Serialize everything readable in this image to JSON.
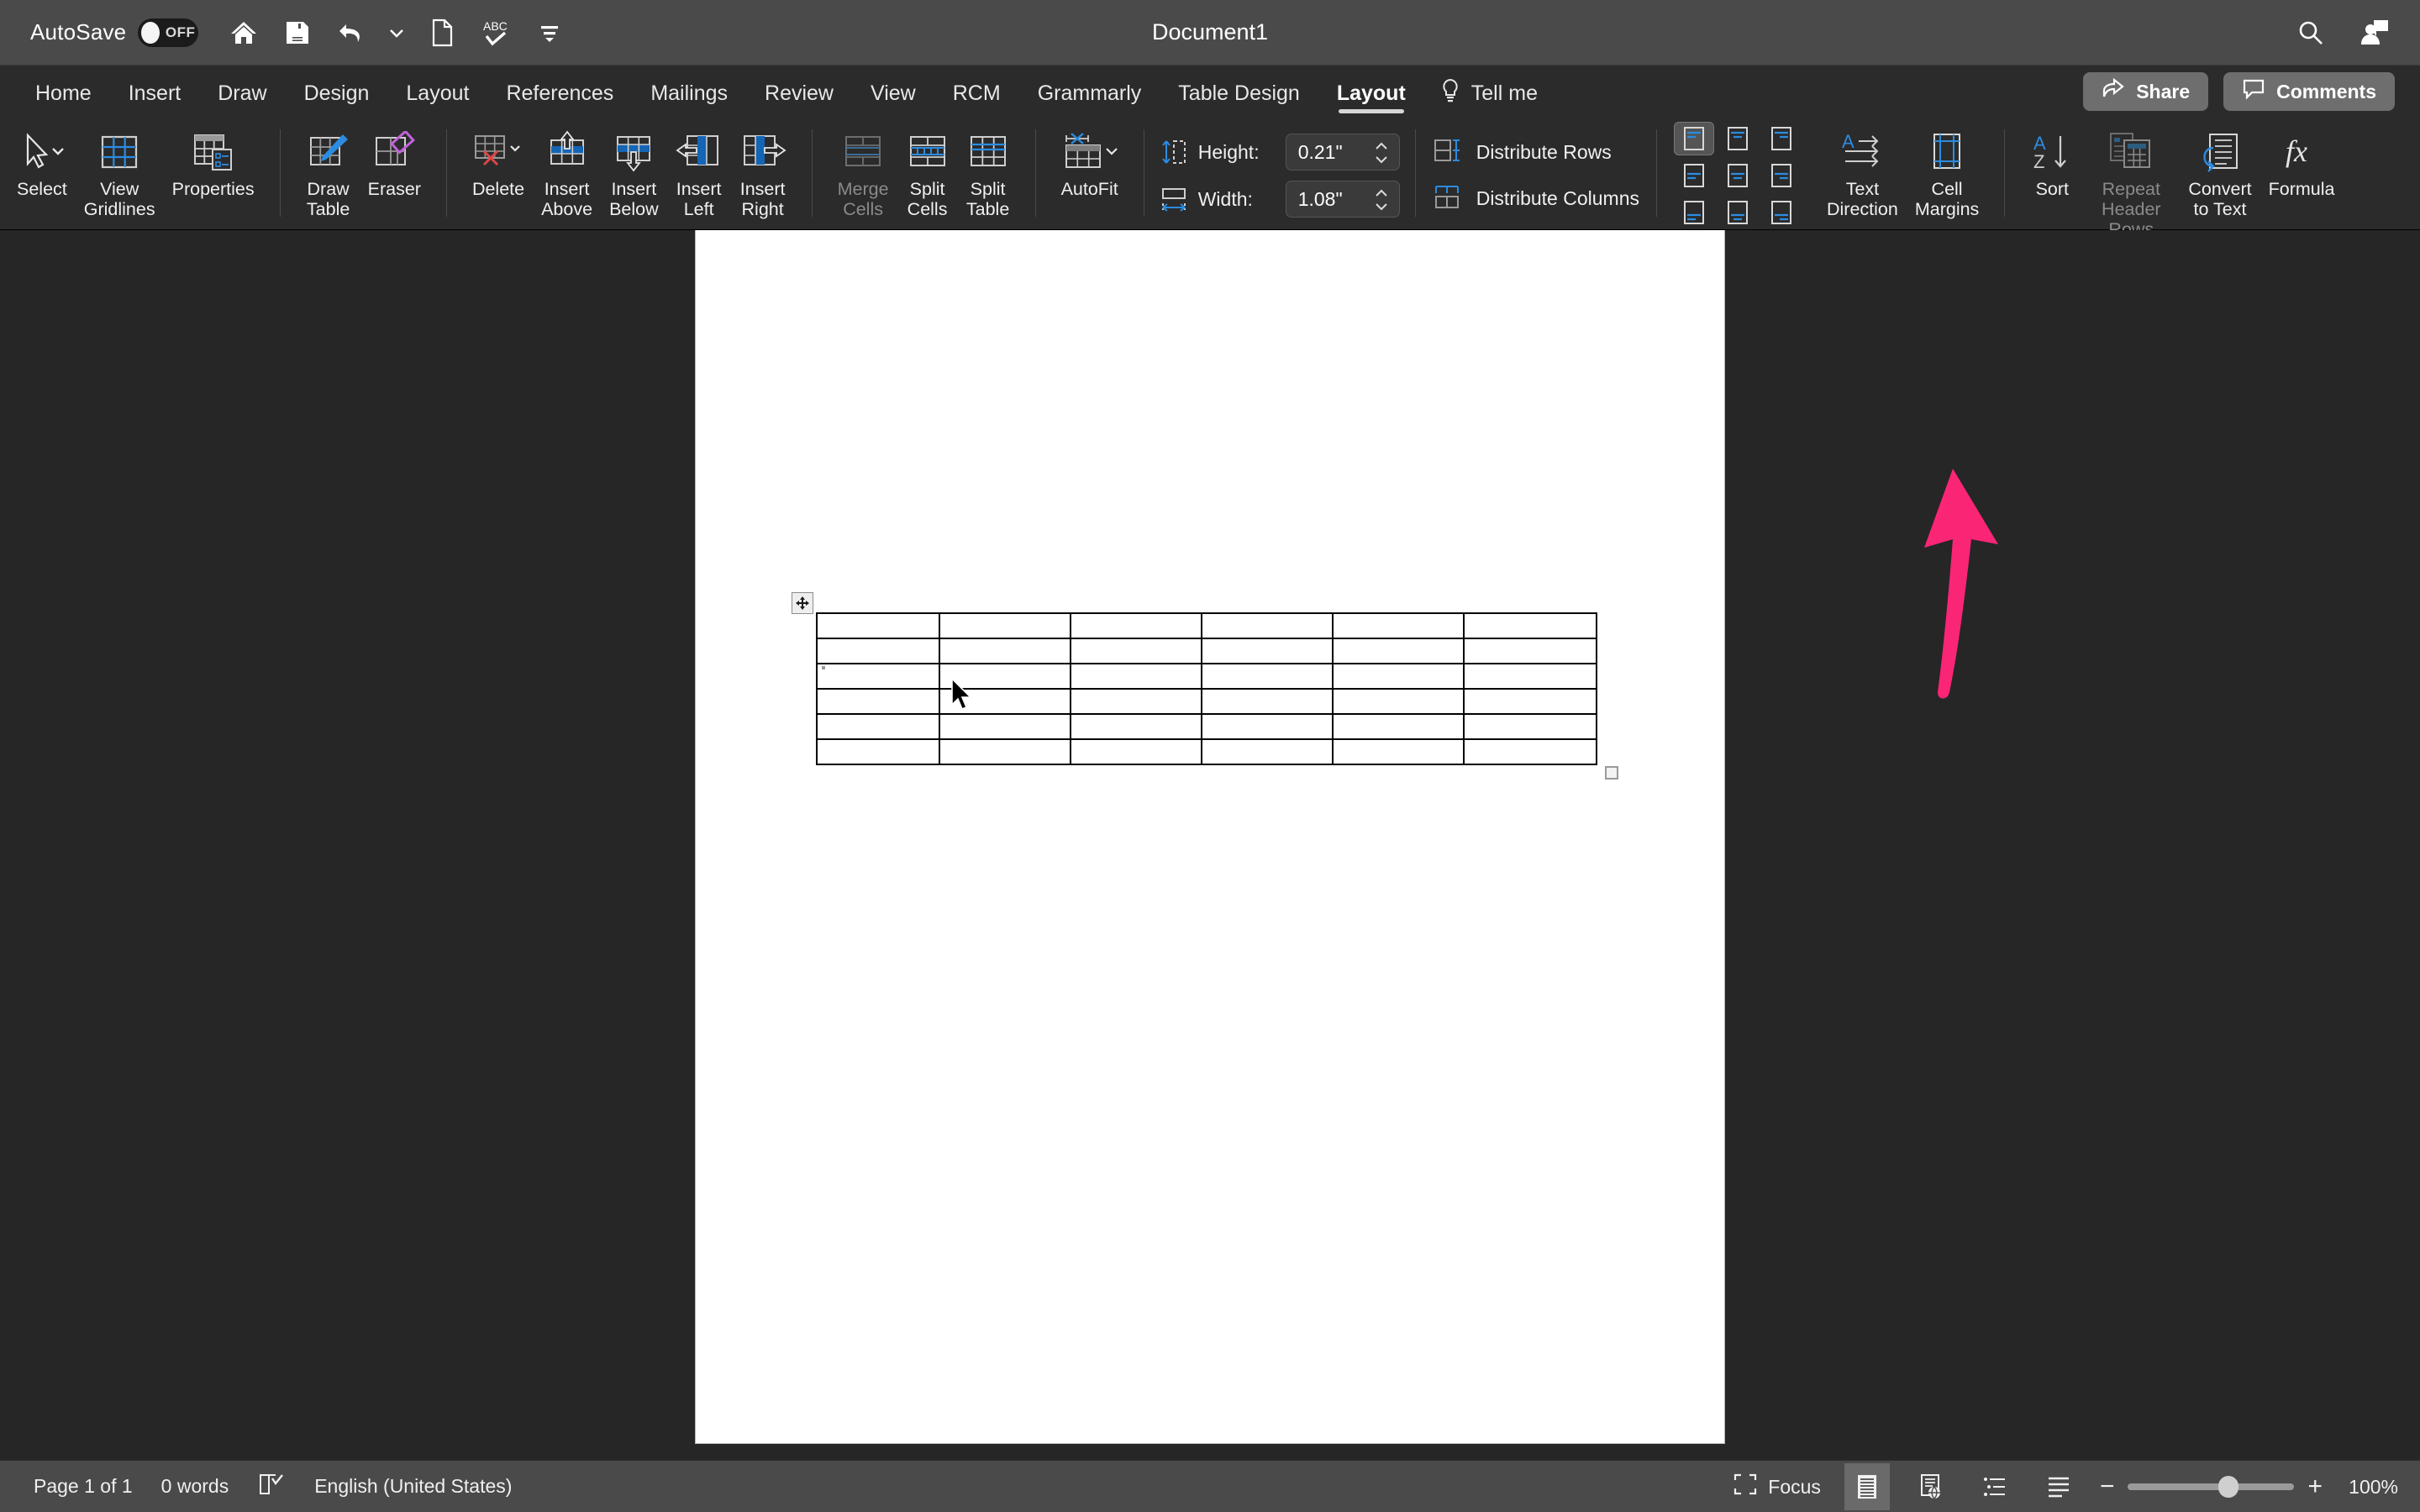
{
  "titlebar": {
    "autosave_label": "AutoSave",
    "autosave_state": "OFF",
    "document_title": "Document1",
    "icons": [
      "home-icon",
      "save-icon",
      "undo-icon",
      "undo-dropdown-icon",
      "new-document-icon",
      "spelling-icon",
      "customize-toolbar-icon"
    ],
    "right_icons": [
      "search-icon",
      "account-icon"
    ]
  },
  "tabs": {
    "items": [
      {
        "label": "Home",
        "active": false
      },
      {
        "label": "Insert",
        "active": false
      },
      {
        "label": "Draw",
        "active": false
      },
      {
        "label": "Design",
        "active": false
      },
      {
        "label": "Layout",
        "active": false
      },
      {
        "label": "References",
        "active": false
      },
      {
        "label": "Mailings",
        "active": false
      },
      {
        "label": "Review",
        "active": false
      },
      {
        "label": "View",
        "active": false
      },
      {
        "label": "RCM",
        "active": false
      },
      {
        "label": "Grammarly",
        "active": false
      },
      {
        "label": "Table Design",
        "active": false
      },
      {
        "label": "Layout",
        "active": true
      }
    ],
    "tell_me": "Tell me",
    "share_label": "Share",
    "comments_label": "Comments"
  },
  "ribbon": {
    "select": "Select",
    "view_gridlines": "View\nGridlines",
    "properties": "Properties",
    "draw_table": "Draw\nTable",
    "eraser": "Eraser",
    "delete": "Delete",
    "insert_above": "Insert\nAbove",
    "insert_below": "Insert\nBelow",
    "insert_left": "Insert\nLeft",
    "insert_right": "Insert\nRight",
    "merge_cells": "Merge\nCells",
    "split_cells": "Split\nCells",
    "split_table": "Split\nTable",
    "autofit": "AutoFit",
    "height_label": "Height:",
    "height_value": "0.21\"",
    "width_label": "Width:",
    "width_value": "1.08\"",
    "distribute_rows": "Distribute Rows",
    "distribute_columns": "Distribute Columns",
    "text_direction": "Text\nDirection",
    "cell_margins": "Cell\nMargins",
    "sort": "Sort",
    "repeat_header_rows": "Repeat\nHeader Rows",
    "convert_to_text": "Convert\nto Text",
    "formula": "Formula",
    "alignment_selected_index": 0
  },
  "document": {
    "table": {
      "rows": 6,
      "cols": 6
    },
    "annotation": {
      "type": "arrow",
      "color": "#FB2576",
      "points_to": "cell-margins-button"
    }
  },
  "statusbar": {
    "page_info": "Page 1 of 1",
    "word_count": "0 words",
    "proofing_icon": "proofing-check-icon",
    "language": "English (United States)",
    "focus_label": "Focus",
    "zoom_level": "100%",
    "zoom_minus": "−",
    "zoom_plus": "+",
    "view_buttons": [
      "print-layout-icon",
      "web-layout-icon",
      "outline-icon",
      "draft-icon"
    ]
  },
  "colors": {
    "titlebar_bg": "#4A4A4A",
    "ribbon_bg": "#2B2B2B",
    "workspace_bg": "#262626",
    "accent_blue": "#2B8CE0",
    "annotation_pink": "#FB2576",
    "page_white": "#FFFFFF"
  }
}
